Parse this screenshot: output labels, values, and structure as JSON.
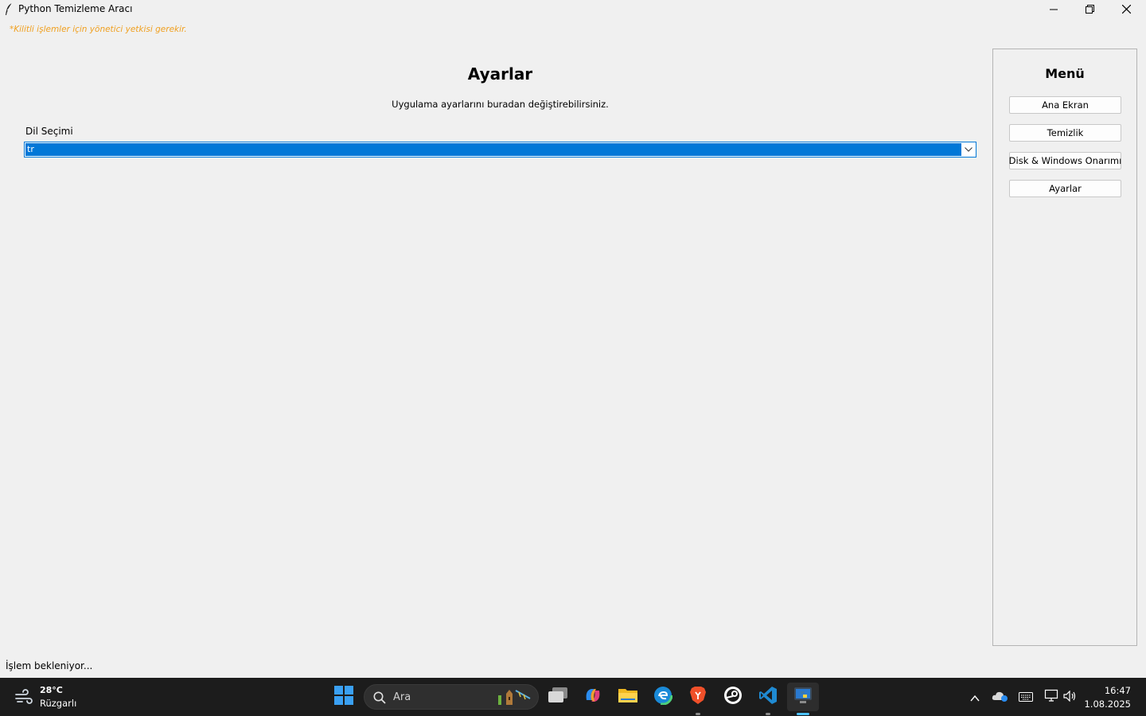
{
  "window": {
    "title": "Python Temizleme Aracı",
    "controls": {
      "minimize_icon": "minimize-icon",
      "maximize_icon": "restore-icon",
      "close_icon": "close-icon"
    }
  },
  "warning_text": "*Kilitli işlemler için yönetici yetkisi gerekir.",
  "main": {
    "title": "Ayarlar",
    "subtitle": "Uygulama ayarlarını buradan değiştirebilirsiniz.",
    "language_label": "Dil Seçimi",
    "language_value": "tr"
  },
  "menu": {
    "title": "Menü",
    "items": [
      {
        "label": "Ana Ekran"
      },
      {
        "label": "Temizlik"
      },
      {
        "label": "Disk & Windows Onarımı"
      },
      {
        "label": "Ayarlar"
      }
    ]
  },
  "status_text": "İşlem bekleniyor...",
  "taskbar": {
    "weather": {
      "temperature": "28°C",
      "description": "Rüzgarlı"
    },
    "search_placeholder": "Ara",
    "apps": [
      "start-icon",
      "task-view-icon",
      "copilot-icon",
      "file-explorer-icon",
      "edge-icon",
      "brave-icon",
      "steam-icon",
      "vscode-icon",
      "python-icon"
    ],
    "clock": {
      "time": "16:47",
      "date": "1.08.2025"
    }
  },
  "colors": {
    "accent": "#0078d7",
    "warning": "#f0a020",
    "taskbar": "#1c1c1c",
    "background": "#f0f0f0"
  }
}
